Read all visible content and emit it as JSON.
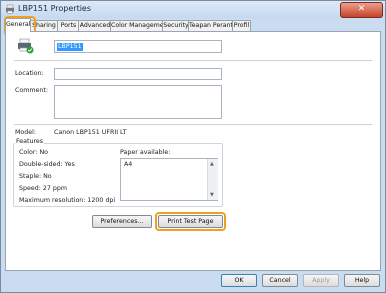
{
  "window": {
    "title": "LBP151 Properties",
    "close_label": "✕"
  },
  "tabs": [
    "General",
    "Sharing",
    "Ports",
    "Advanced",
    "Color Management",
    "Security",
    "Teapan Peranti",
    "Profil"
  ],
  "general": {
    "printer_name": "LBP151",
    "location_label": "Location:",
    "location_value": "",
    "comment_label": "Comment:",
    "comment_value": "",
    "model_label": "Model:",
    "model_value": "Canon LBP151 UFRII LT",
    "features_label": "Features",
    "features": {
      "color": "Color: No",
      "double_sided": "Double-sided: Yes",
      "staple": "Staple: No",
      "speed": "Speed: 27 ppm",
      "max_res": "Maximum resolution: 1200 dpi"
    },
    "paper_label": "Paper available:",
    "paper_items": [
      "A4"
    ],
    "preferences_label": "Preferences...",
    "print_test_label": "Print Test Page"
  },
  "footer": {
    "ok": "OK",
    "cancel": "Cancel",
    "apply": "Apply",
    "help": "Help"
  },
  "colors": {
    "highlight": "#f0a020",
    "selection": "#3399ff"
  }
}
